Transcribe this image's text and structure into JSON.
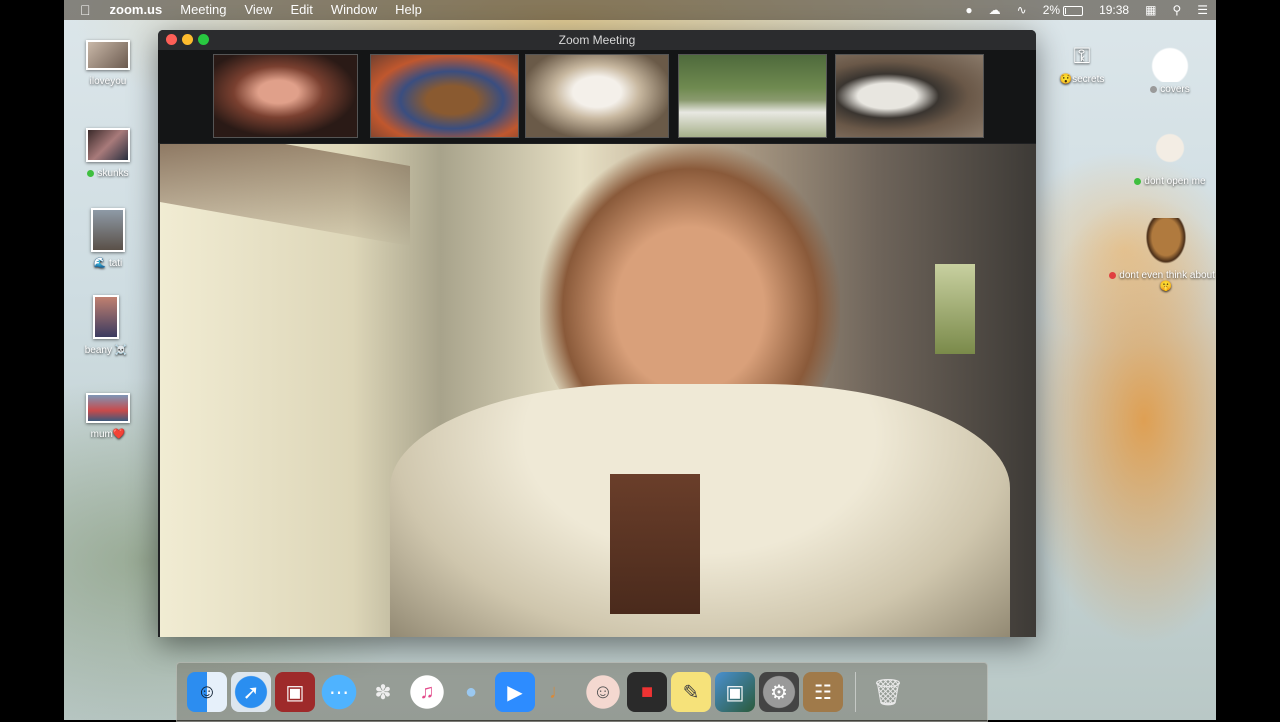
{
  "menubar": {
    "app": "zoom.us",
    "items": [
      "Meeting",
      "View",
      "Edit",
      "Window",
      "Help"
    ],
    "battery": "2%",
    "time": "19:38"
  },
  "desktop_left": [
    {
      "label": "iloveyou"
    },
    {
      "label": "skunks",
      "tag_color": "#3fbf3f"
    },
    {
      "label": "tati",
      "emoji": "🌊"
    },
    {
      "label": "beany",
      "emoji": "☠️"
    },
    {
      "label": "mum",
      "emoji": "❤️"
    }
  ],
  "desktop_right": [
    {
      "label": "secrets",
      "emoji": "😯"
    },
    {
      "label": "covers",
      "tag_color": "#9a9a9a"
    },
    {
      "label": "dont open me",
      "tag_color": "#3fbf3f"
    },
    {
      "label": "dont even think about it",
      "emoji": "🤫",
      "tag_color": "#e04040"
    }
  ],
  "window": {
    "title": "Zoom Meeting"
  },
  "colors": {
    "close": "#fe5f57",
    "minimize": "#febc2e",
    "zoom": "#28c840"
  },
  "dock": {
    "apps": [
      "finder-icon",
      "safari-icon",
      "photo-booth-icon",
      "messages-icon",
      "rabbit-icon",
      "itunes-icon",
      "seal-icon",
      "zoom-icon",
      "garageband-icon",
      "face-icon",
      "photo-editor-icon",
      "stickies-icon",
      "preview-icon",
      "system-preferences-icon",
      "contacts-icon"
    ],
    "trash": "trash-icon"
  }
}
